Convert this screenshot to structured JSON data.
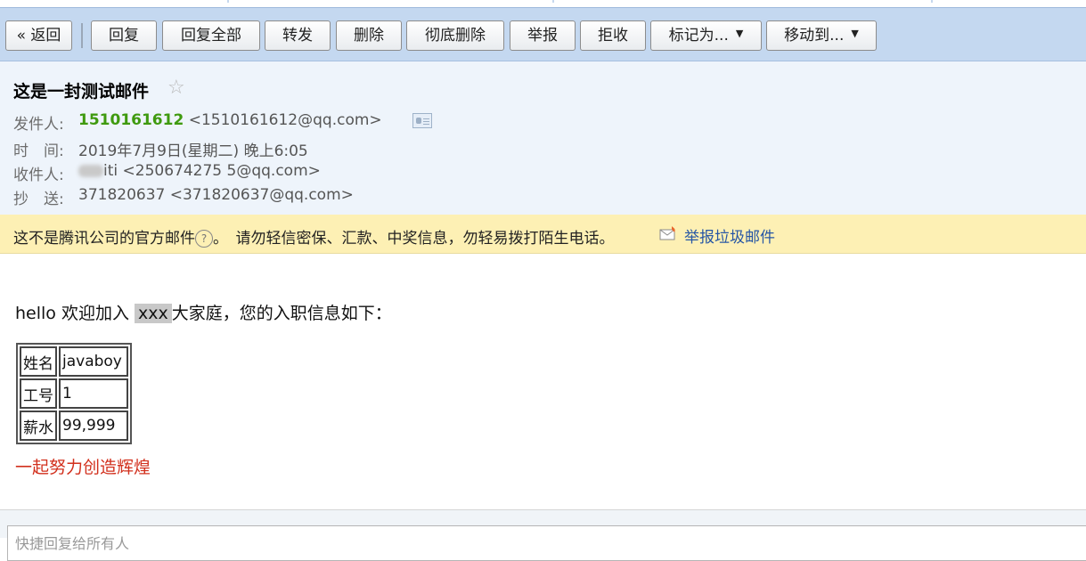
{
  "toolbar": {
    "back": "« 返回",
    "reply": "回复",
    "reply_all": "回复全部",
    "forward": "转发",
    "delete": "删除",
    "delete_forever": "彻底删除",
    "report": "举报",
    "reject": "拒收",
    "mark_as": "标记为...",
    "move_to": "移动到..."
  },
  "email": {
    "subject": "这是一封测试邮件",
    "star": "☆",
    "from_label": "发件人:",
    "from_name": "1510161612",
    "from_address": "<1510161612@qq.com>",
    "time_label": "时　间:",
    "time": "2019年7月9日(星期二) 晚上6:05",
    "to_label": "收件人:",
    "to_name_suffix": "iti",
    "to_address": "<250674275 5@qq.com>",
    "cc_label": "抄　送:",
    "cc_name": "371820637",
    "cc_address": "<371820637@qq.com>"
  },
  "warning": {
    "text1": "这不是腾讯公司的官方邮件",
    "q": "?",
    "text2": "。　请勿轻信密保、汇款、中奖信息，勿轻易拨打陌生电话。",
    "report_link": "举报垃圾邮件"
  },
  "content": {
    "greeting_pre": "hello 欢迎加入",
    "highlight": "xxx",
    "greeting_post": "大家庭，您的入职信息如下：",
    "table": [
      {
        "k": "姓名",
        "v": "javaboy"
      },
      {
        "k": "工号",
        "v": "1"
      },
      {
        "k": "薪水",
        "v": "99,999"
      }
    ],
    "slogan": "一起努力创造辉煌"
  },
  "reply_box": {
    "placeholder": "快捷回复给所有人"
  },
  "colors": {
    "toolbar_bg": "#c4d8f0",
    "header_bg": "#eef4fb",
    "warn_bg": "#fdf0b4",
    "sender_green": "#3f9a0f",
    "link_blue": "#2656a5",
    "slogan_red": "#d2301d"
  }
}
